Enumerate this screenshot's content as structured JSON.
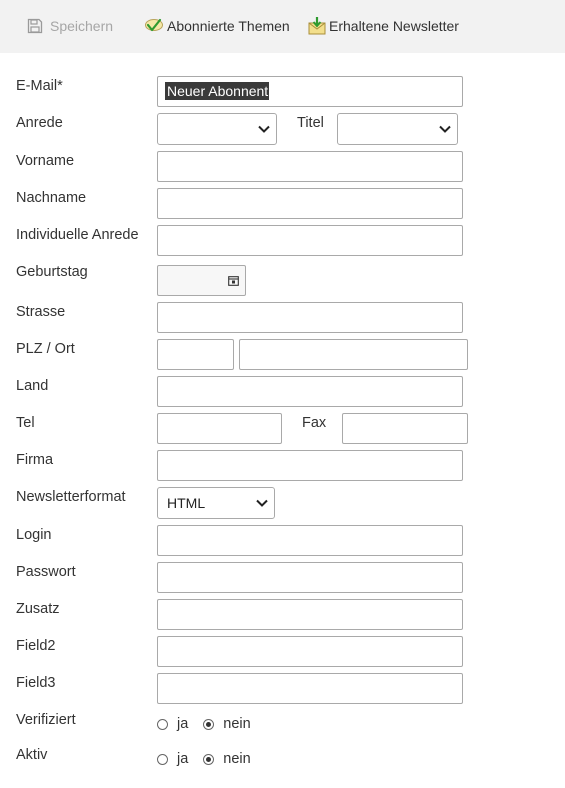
{
  "toolbar": {
    "save_label": "Speichern",
    "topics_label": "Abonnierte Themen",
    "newsletters_label": "Erhaltene Newsletter"
  },
  "form": {
    "email_label": "E-Mail*",
    "email_value": "Neuer Abonnent",
    "salutation_label": "Anrede",
    "salutation_value": "",
    "title_label": "Titel",
    "title_value": "",
    "firstname_label": "Vorname",
    "lastname_label": "Nachname",
    "custom_salutation_label": "Individuelle Anrede",
    "birthday_label": "Geburtstag",
    "street_label": "Strasse",
    "zip_city_label": "PLZ / Ort",
    "country_label": "Land",
    "phone_label": "Tel",
    "fax_label": "Fax",
    "company_label": "Firma",
    "format_label": "Newsletterformat",
    "format_value": "HTML",
    "login_label": "Login",
    "password_label": "Passwort",
    "extra_label": "Zusatz",
    "field2_label": "Field2",
    "field3_label": "Field3",
    "verified_label": "Verifiziert",
    "active_label": "Aktiv",
    "yes_label": "ja",
    "no_label": "nein",
    "verified_value": "nein",
    "active_value": "nein"
  },
  "colors": {
    "toolbar_bg": "#f2f2f2",
    "selection_bg": "#3a3a3a",
    "border": "#a9a9a9"
  },
  "icons": {
    "save": "floppy-disk-icon",
    "topics": "topics-check-icon",
    "newsletters": "envelope-download-icon",
    "calendar": "calendar-icon"
  }
}
